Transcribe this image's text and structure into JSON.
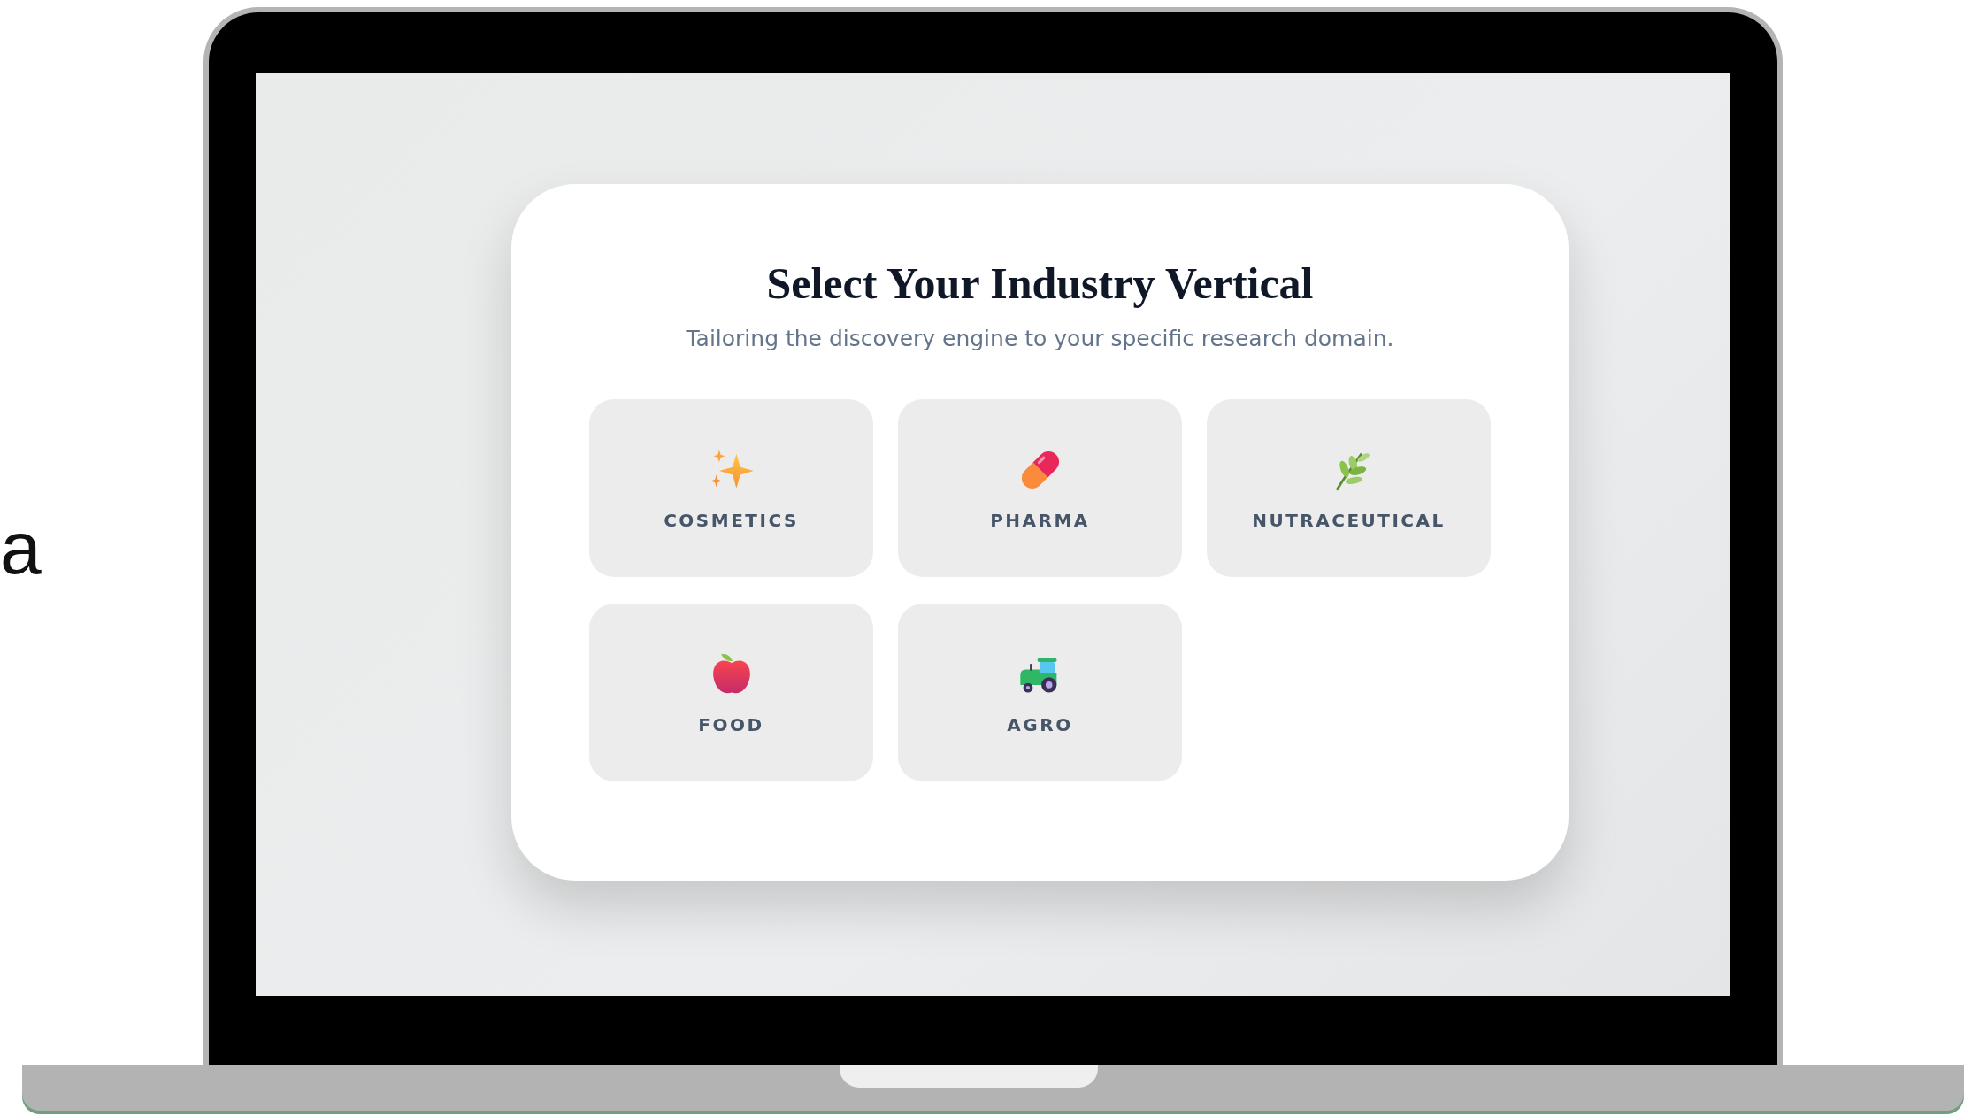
{
  "figure_label": "a",
  "card": {
    "title": "Select Your Industry Vertical",
    "subtitle": "Tailoring the discovery engine to your specific research domain."
  },
  "industries": [
    {
      "label": "COSMETICS",
      "kind": "sparkles"
    },
    {
      "label": "PHARMA",
      "kind": "pill"
    },
    {
      "label": "NUTRACEUTICAL",
      "kind": "herb"
    },
    {
      "label": "FOOD",
      "kind": "apple"
    },
    {
      "label": "AGRO",
      "kind": "tractor"
    }
  ]
}
